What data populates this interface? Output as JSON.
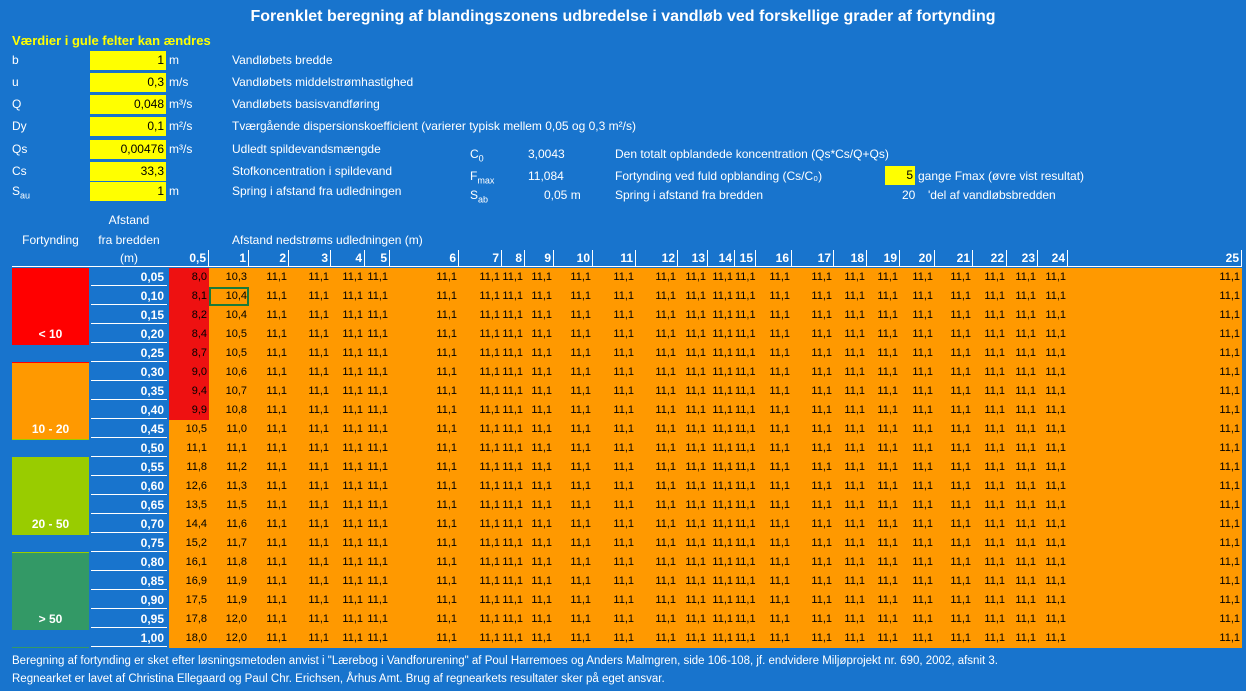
{
  "title": "Forenklet beregning af blandingszonens udbredelse i vandløb ved forskellige grader af fortynding",
  "subtitle": "Værdier i gule felter kan ændres",
  "params": [
    {
      "name": "b",
      "value": "1",
      "unit": "m",
      "desc": "Vandløbets bredde"
    },
    {
      "name": "u",
      "value": "0,3",
      "unit": "m/s",
      "desc": "Vandløbets middelstrømhastighed"
    },
    {
      "name": "Q",
      "value": "0,048",
      "unit": "m³/s",
      "desc": "Vandløbets basisvandføring"
    },
    {
      "name": "Dy",
      "value": "0,1",
      "unit": "m²/s",
      "desc": "Tværgående dispersionskoefficient (varierer typisk mellem 0,05 og 0,3 m²/s)"
    },
    {
      "name": "Qs",
      "value": "0,00476",
      "unit": "m³/s",
      "desc": "Udledt spildevandsmængde"
    },
    {
      "name": "Cs",
      "value": "33,3",
      "unit": "",
      "desc": "Stofkoncentration i spildevand"
    },
    {
      "name": "Sau",
      "value": "1",
      "unit": "m",
      "desc": "Spring i afstand fra udledningen"
    }
  ],
  "derived": {
    "c0_label": "C₀",
    "c0_value": "3,0043",
    "c0_desc": "Den totalt opblandede koncentration (Qs*Cs/Q+Qs)",
    "fmax_label": "Fmax",
    "fmax_value": "11,084",
    "fmax_desc": "Fortynding ved fuld opblanding (Cs/C₀)",
    "fmax_factor": "5",
    "fmax_factor_desc": "gange Fmax (øvre vist resultat)",
    "sab_label": "Sab",
    "sab_value": "0,05 m",
    "sab_desc": "Spring i afstand fra bredden",
    "del_value": "20",
    "del_desc": "'del af vandløbsbredden"
  },
  "grid_headers": {
    "fortynding": "Fortynding",
    "afstand": "Afstand",
    "fra_bredden": "fra bredden",
    "unit_m": "(m)",
    "afstand_ned": "Afstand nedstrøms udledningen (m)"
  },
  "columns": [
    "0,5",
    "1",
    "2",
    "3",
    "4",
    "5",
    "6",
    "7",
    "8",
    "9",
    "10",
    "11",
    "12",
    "13",
    "14",
    "15",
    "16",
    "17",
    "18",
    "19",
    "20",
    "21",
    "22",
    "23",
    "24",
    "25"
  ],
  "bands": [
    {
      "label": "< 10",
      "color": "#FF0000"
    },
    {
      "label": "10 - 20",
      "color": "#FF9900"
    },
    {
      "label": "20 - 50",
      "color": "#99CC00"
    },
    {
      "label": "> 50",
      "color": "#339966"
    }
  ],
  "rows": [
    {
      "dist": "0,05",
      "c05": "8,0",
      "c1": "10,3"
    },
    {
      "dist": "0,10",
      "c05": "8,1",
      "c1": "10,4"
    },
    {
      "dist": "0,15",
      "c05": "8,2",
      "c1": "10,4"
    },
    {
      "dist": "0,20",
      "c05": "8,4",
      "c1": "10,5"
    },
    {
      "dist": "0,25",
      "c05": "8,7",
      "c1": "10,5"
    },
    {
      "dist": "0,30",
      "c05": "9,0",
      "c1": "10,6"
    },
    {
      "dist": "0,35",
      "c05": "9,4",
      "c1": "10,7"
    },
    {
      "dist": "0,40",
      "c05": "9,9",
      "c1": "10,8"
    },
    {
      "dist": "0,45",
      "c05": "10,5",
      "c1": "11,0"
    },
    {
      "dist": "0,50",
      "c05": "11,1",
      "c1": "11,1"
    },
    {
      "dist": "0,55",
      "c05": "11,8",
      "c1": "11,2"
    },
    {
      "dist": "0,60",
      "c05": "12,6",
      "c1": "11,3"
    },
    {
      "dist": "0,65",
      "c05": "13,5",
      "c1": "11,5"
    },
    {
      "dist": "0,70",
      "c05": "14,4",
      "c1": "11,6"
    },
    {
      "dist": "0,75",
      "c05": "15,2",
      "c1": "11,7"
    },
    {
      "dist": "0,80",
      "c05": "16,1",
      "c1": "11,8"
    },
    {
      "dist": "0,85",
      "c05": "16,9",
      "c1": "11,9"
    },
    {
      "dist": "0,90",
      "c05": "17,5",
      "c1": "11,9"
    },
    {
      "dist": "0,95",
      "c05": "17,8",
      "c1": "12,0"
    },
    {
      "dist": "1,00",
      "c05": "18,0",
      "c1": "12,0"
    }
  ],
  "fill_value": "11,1",
  "footer": [
    "Beregning af fortynding er sket efter løsningsmetoden anvist i \"Lærebog i Vandforurening\" af Poul Harremoes og Anders Malmgren, side 106-108, jf. endvidere Miljøprojekt nr. 690, 2002, afsnit 3.",
    "Regnearket er lavet af Christina Ellegaard og Paul Chr. Erichsen, Århus Amt. Brug af regnearkets resultater sker på eget ansvar."
  ]
}
